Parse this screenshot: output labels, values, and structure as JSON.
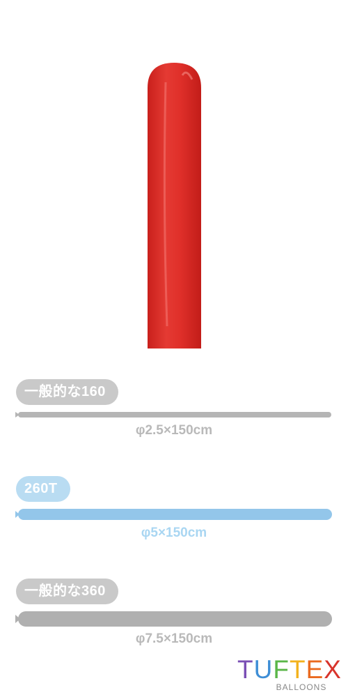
{
  "balloon": {
    "color": "#e0302a"
  },
  "sizes": [
    {
      "label": "一般的な160",
      "dimension": "φ2.5×150cm",
      "color": "#b9b9b9",
      "bar_color": "#b5b5b5"
    },
    {
      "label": "260T",
      "dimension": "φ5×150cm",
      "color": "#a9d6f2",
      "bar_color": "#93c6ea"
    },
    {
      "label": "一般的な360",
      "dimension": "φ7.5×150cm",
      "color": "#b9b9b9",
      "bar_color": "#b0b0b0"
    }
  ],
  "logo": {
    "letters": [
      "T",
      "U",
      "F",
      "T",
      "E",
      "X"
    ],
    "letter_colors": [
      "#7a4fb5",
      "#3e8ed6",
      "#5ab648",
      "#f3b21d",
      "#ea6a1f",
      "#d8342c"
    ],
    "subtitle": "BALLOONS"
  }
}
